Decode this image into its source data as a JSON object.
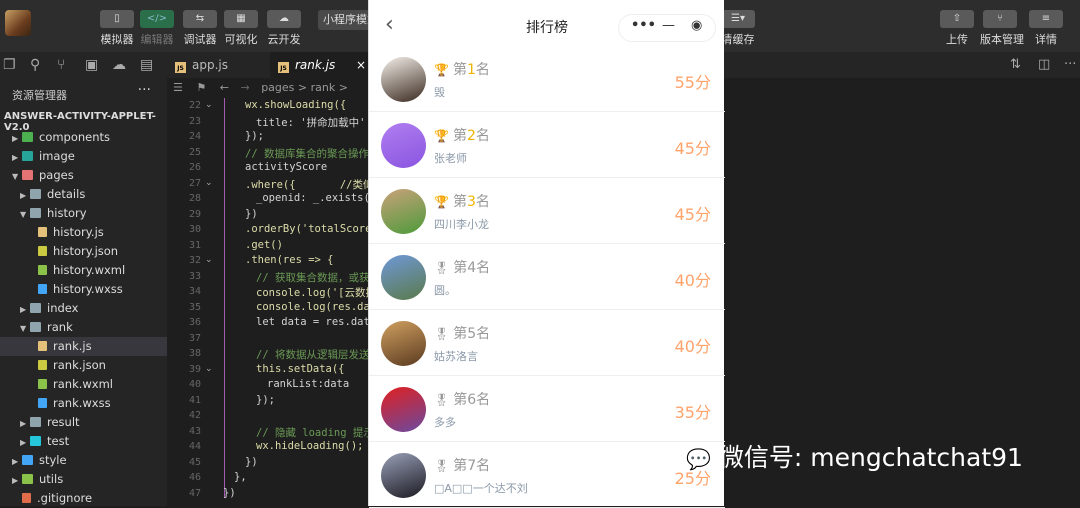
{
  "toolbar": {
    "left": [
      {
        "label": "模拟器",
        "icon": "phone-icon",
        "glyph": "▯"
      },
      {
        "label": "编辑器",
        "icon": "code-icon",
        "glyph": "</>"
      },
      {
        "label": "调试器",
        "icon": "sliders-icon",
        "glyph": "⇆"
      },
      {
        "label": "可视化",
        "icon": "layout-icon",
        "glyph": "▦"
      },
      {
        "label": "云开发",
        "icon": "cloud-icon",
        "glyph": "☁"
      }
    ],
    "mode_select": "小程序模式",
    "cache_label": "清缓存",
    "right": [
      {
        "label": "上传",
        "icon": "upload-icon",
        "glyph": "⇧"
      },
      {
        "label": "版本管理",
        "icon": "branch-icon",
        "glyph": "⑂"
      },
      {
        "label": "详情",
        "icon": "menu-icon",
        "glyph": "≡"
      }
    ]
  },
  "tabs": [
    {
      "label": "app.js"
    },
    {
      "label": "rank.js",
      "close": "×"
    }
  ],
  "breadcrumb": "pages > rank > ",
  "sidebar": {
    "title": "资源管理器",
    "more": "···",
    "project": "ANSWER-ACTIVITY-APPLET-V2.0",
    "items": [
      {
        "label": "components",
        "depth": 1,
        "type": "folder",
        "open": false,
        "color": "#4caf50"
      },
      {
        "label": "image",
        "depth": 1,
        "type": "folder",
        "open": false,
        "color": "#26a69a"
      },
      {
        "label": "pages",
        "depth": 1,
        "type": "folder",
        "open": true,
        "color": "#e57373"
      },
      {
        "label": "details",
        "depth": 2,
        "type": "folder",
        "open": false,
        "color": "#90a4ae"
      },
      {
        "label": "history",
        "depth": 2,
        "type": "folder",
        "open": true,
        "color": "#90a4ae"
      },
      {
        "label": "history.js",
        "depth": 3,
        "type": "file",
        "color": "#e5c07b"
      },
      {
        "label": "history.json",
        "depth": 3,
        "type": "file",
        "color": "#cbcb41"
      },
      {
        "label": "history.wxml",
        "depth": 3,
        "type": "file",
        "color": "#8bc34a"
      },
      {
        "label": "history.wxss",
        "depth": 3,
        "type": "file",
        "color": "#42a5f5"
      },
      {
        "label": "index",
        "depth": 2,
        "type": "folder",
        "open": false,
        "color": "#90a4ae"
      },
      {
        "label": "rank",
        "depth": 2,
        "type": "folder",
        "open": true,
        "color": "#90a4ae"
      },
      {
        "label": "rank.js",
        "depth": 3,
        "type": "file",
        "color": "#e5c07b",
        "selected": true
      },
      {
        "label": "rank.json",
        "depth": 3,
        "type": "file",
        "color": "#cbcb41"
      },
      {
        "label": "rank.wxml",
        "depth": 3,
        "type": "file",
        "color": "#8bc34a"
      },
      {
        "label": "rank.wxss",
        "depth": 3,
        "type": "file",
        "color": "#42a5f5"
      },
      {
        "label": "result",
        "depth": 2,
        "type": "folder",
        "open": false,
        "color": "#90a4ae"
      },
      {
        "label": "test",
        "depth": 2,
        "type": "folder",
        "open": false,
        "color": "#26c6da"
      },
      {
        "label": "style",
        "depth": 1,
        "type": "folder",
        "open": false,
        "color": "#42a5f5"
      },
      {
        "label": "utils",
        "depth": 1,
        "type": "folder",
        "open": false,
        "color": "#8bc34a"
      },
      {
        "label": ".gitignore",
        "depth": 1,
        "type": "file",
        "color": "#e06c4b"
      }
    ]
  },
  "code": [
    {
      "n": "22",
      "fold": true,
      "indent": 0,
      "text": "wx.showLoading({"
    },
    {
      "n": "23",
      "indent": 1,
      "text": "title: '拼命加载中'"
    },
    {
      "n": "24",
      "indent": 0,
      "text": "});"
    },
    {
      "n": "25",
      "indent": 0,
      "text": "// 数据库集合的聚合操作实",
      "comment": true
    },
    {
      "n": "26",
      "indent": 0,
      "text": "activityScore"
    },
    {
      "n": "27",
      "fold": true,
      "indent": 0,
      "text": ".where({       //类似于"
    },
    {
      "n": "28",
      "indent": 1,
      "text": "_openid: _.exists(tr"
    },
    {
      "n": "29",
      "indent": 0,
      "text": "})"
    },
    {
      "n": "30",
      "indent": 0,
      "text": ".orderBy('totalScore',"
    },
    {
      "n": "31",
      "indent": 0,
      "text": ".get()"
    },
    {
      "n": "32",
      "fold": true,
      "indent": 0,
      "text": ".then(res => {"
    },
    {
      "n": "33",
      "indent": 1,
      "text": "// 获取集合数据，或获取",
      "comment": true
    },
    {
      "n": "34",
      "indent": 1,
      "text": "console.log('[云数据"
    },
    {
      "n": "35",
      "indent": 1,
      "text": "console.log(res.data"
    },
    {
      "n": "36",
      "indent": 1,
      "text": "let data = res.data"
    },
    {
      "n": "37",
      "indent": 1,
      "text": ""
    },
    {
      "n": "38",
      "indent": 1,
      "text": "// 将数据从逻辑层发送",
      "comment": true
    },
    {
      "n": "39",
      "fold": true,
      "indent": 1,
      "text": "this.setData({"
    },
    {
      "n": "40",
      "indent": 2,
      "text": "rankList:data"
    },
    {
      "n": "41",
      "indent": 1,
      "text": "});"
    },
    {
      "n": "42",
      "indent": 1,
      "text": ""
    },
    {
      "n": "43",
      "indent": 1,
      "text": "// 隐藏 loading 提示框",
      "comment": true
    },
    {
      "n": "44",
      "indent": 1,
      "text": "wx.hideLoading();"
    },
    {
      "n": "45",
      "indent": 0,
      "text": "})"
    },
    {
      "n": "46",
      "indent": -1,
      "text": "},"
    },
    {
      "n": "47",
      "indent": -2,
      "text": "})"
    }
  ],
  "phone": {
    "title": "排行榜",
    "back_icon": "chevron-left-icon",
    "rows": [
      {
        "prefix": "第",
        "rank": "1",
        "suffix": "名",
        "name": "毁",
        "score": "55分",
        "medal": "trophy",
        "avatar": [
          "#f5f0ea",
          "#3a2a20"
        ]
      },
      {
        "prefix": "第",
        "rank": "2",
        "suffix": "名",
        "name": "张老师",
        "score": "45分",
        "medal": "trophy",
        "avatar": [
          "#b07ef0",
          "#8a55e0"
        ]
      },
      {
        "prefix": "第",
        "rank": "3",
        "suffix": "名",
        "name": "四川李小龙",
        "score": "45分",
        "medal": "trophy",
        "avatar": [
          "#c9a27a",
          "#4d9a3a"
        ]
      },
      {
        "prefix": "第",
        "rank": "4",
        "suffix": "名",
        "name": "圆。",
        "score": "40分",
        "medal": "medal",
        "avatar": [
          "#6f98d8",
          "#5a7a4a"
        ]
      },
      {
        "prefix": "第",
        "rank": "5",
        "suffix": "名",
        "name": "姑苏洛言",
        "score": "40分",
        "medal": "medal",
        "avatar": [
          "#d0a060",
          "#5a3a20"
        ]
      },
      {
        "prefix": "第",
        "rank": "6",
        "suffix": "名",
        "name": "多多",
        "score": "35分",
        "medal": "medal",
        "avatar": [
          "#e02020",
          "#6a4aa0"
        ]
      },
      {
        "prefix": "第",
        "rank": "7",
        "suffix": "名",
        "name": "□A□□一个达不刘",
        "score": "25分",
        "medal": "medal",
        "avatar": [
          "#9aa0b8",
          "#1a1a22"
        ]
      }
    ]
  },
  "watermark": "微信号: mengchatchat91",
  "colors": {
    "accent_gold": "#f0b400",
    "score": "#ffa36b",
    "editor_bg": "#1e1e1e"
  }
}
